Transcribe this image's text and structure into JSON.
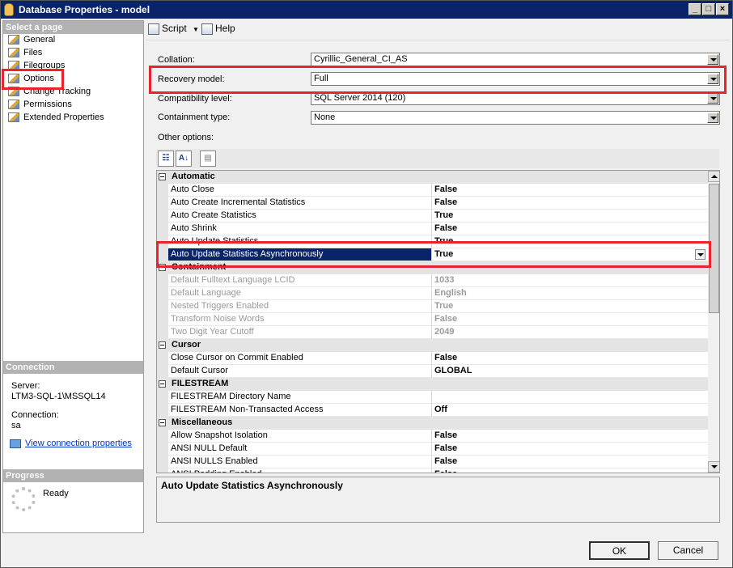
{
  "window": {
    "title": "Database Properties - model"
  },
  "left": {
    "select_page_header": "Select a page",
    "pages": [
      "General",
      "Files",
      "Filegroups",
      "Options",
      "Change Tracking",
      "Permissions",
      "Extended Properties"
    ],
    "selected_page": "Options",
    "connection_header": "Connection",
    "server_label": "Server:",
    "server_value": "LTM3-SQL-1\\MSSQL14",
    "connection_label": "Connection:",
    "connection_value": "sa",
    "view_connection_link": "View connection properties",
    "progress_header": "Progress",
    "progress_status": "Ready"
  },
  "toolbar": {
    "script_label": "Script",
    "help_label": "Help"
  },
  "fields": {
    "collation_label": "Collation:",
    "collation_value": "Cyrillic_General_CI_AS",
    "recovery_label": "Recovery model:",
    "recovery_value": "Full",
    "compat_label": "Compatibility level:",
    "compat_value": "SQL Server 2014 (120)",
    "containment_label": "Containment type:",
    "containment_value": "None",
    "other_options_label": "Other options:"
  },
  "grid": {
    "rows": [
      {
        "kind": "cat",
        "name": "Automatic"
      },
      {
        "kind": "prop",
        "name": "Auto Close",
        "value": "False"
      },
      {
        "kind": "prop",
        "name": "Auto Create Incremental Statistics",
        "value": "False"
      },
      {
        "kind": "prop",
        "name": "Auto Create Statistics",
        "value": "True"
      },
      {
        "kind": "prop",
        "name": "Auto Shrink",
        "value": "False"
      },
      {
        "kind": "prop",
        "name": "Auto Update Statistics",
        "value": "True"
      },
      {
        "kind": "prop",
        "name": "Auto Update Statistics Asynchronously",
        "value": "True",
        "selected": true
      },
      {
        "kind": "cat",
        "name": "Containment"
      },
      {
        "kind": "prop",
        "name": "Default Fulltext Language LCID",
        "value": "1033",
        "disabled": true
      },
      {
        "kind": "prop",
        "name": "Default Language",
        "value": "English",
        "disabled": true
      },
      {
        "kind": "prop",
        "name": "Nested Triggers Enabled",
        "value": "True",
        "disabled": true
      },
      {
        "kind": "prop",
        "name": "Transform Noise Words",
        "value": "False",
        "disabled": true
      },
      {
        "kind": "prop",
        "name": "Two Digit Year Cutoff",
        "value": "2049",
        "disabled": true
      },
      {
        "kind": "cat",
        "name": "Cursor"
      },
      {
        "kind": "prop",
        "name": "Close Cursor on Commit Enabled",
        "value": "False"
      },
      {
        "kind": "prop",
        "name": "Default Cursor",
        "value": "GLOBAL"
      },
      {
        "kind": "cat",
        "name": "FILESTREAM"
      },
      {
        "kind": "prop",
        "name": "FILESTREAM Directory Name",
        "value": ""
      },
      {
        "kind": "prop",
        "name": "FILESTREAM Non-Transacted Access",
        "value": "Off"
      },
      {
        "kind": "cat",
        "name": "Miscellaneous"
      },
      {
        "kind": "prop",
        "name": "Allow Snapshot Isolation",
        "value": "False"
      },
      {
        "kind": "prop",
        "name": "ANSI NULL Default",
        "value": "False"
      },
      {
        "kind": "prop",
        "name": "ANSI NULLS Enabled",
        "value": "False"
      },
      {
        "kind": "prop",
        "name": "ANSI Padding Enabled",
        "value": "False"
      }
    ],
    "description": "Auto Update Statistics Asynchronously"
  },
  "buttons": {
    "ok": "OK",
    "cancel": "Cancel"
  },
  "colors": {
    "highlight": "#e8252f",
    "selection": "#0a246a",
    "link": "#0033cc"
  }
}
